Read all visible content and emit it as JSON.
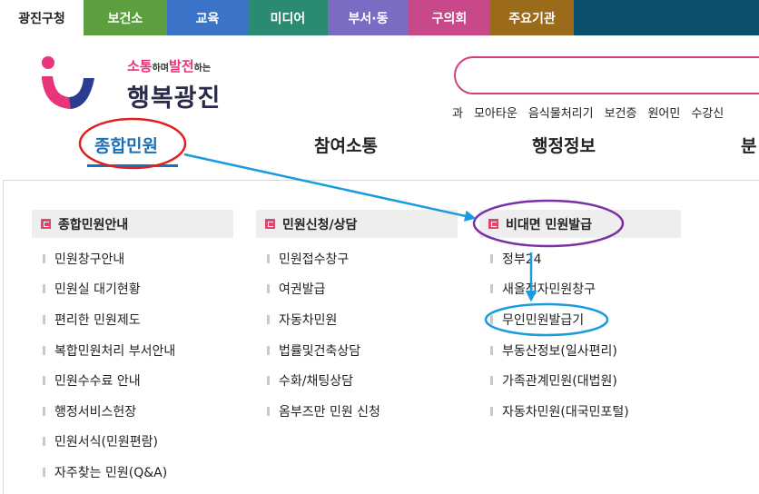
{
  "top_tabs": [
    {
      "label": "광진구청",
      "color": "#ffffff"
    },
    {
      "label": "보건소",
      "color": "#5d9e3f"
    },
    {
      "label": "교육",
      "color": "#3a73c7"
    },
    {
      "label": "미디어",
      "color": "#2a8a72"
    },
    {
      "label": "부서·동",
      "color": "#7b6bc2"
    },
    {
      "label": "구의회",
      "color": "#c8488a"
    },
    {
      "label": "주요기관",
      "color": "#9b6a1a"
    }
  ],
  "logo": {
    "slogan_1": "소통",
    "slogan_2": "하며",
    "slogan_3": "발전",
    "slogan_4": "하는",
    "title": "행복광진"
  },
  "quick_links": [
    "과",
    "모아타운",
    "음식물처리기",
    "보건증",
    "원어민",
    "수강신"
  ],
  "gnb": [
    "종합민원",
    "참여소통",
    "행정정보",
    "분"
  ],
  "columns": [
    {
      "title": "종합민원안내",
      "items": [
        "민원창구안내",
        "민원실 대기현황",
        "편리한 민원제도",
        "복합민원처리 부서안내",
        "민원수수료 안내",
        "행정서비스헌장",
        "민원서식(민원편람)",
        "자주찾는 민원(Q&A)"
      ]
    },
    {
      "title": "민원신청/상담",
      "items": [
        "민원접수창구",
        "여권발급",
        "자동차민원",
        "법률및건축상담",
        "수화/채팅상담",
        "옴부즈만 민원 신청"
      ]
    },
    {
      "title": "비대면 민원발급",
      "items": [
        "정부24",
        "새올전자민원창구",
        "무인민원발급기",
        "부동산정보(일사편리)",
        "가족관계민원(대법원)",
        "자동차민원(대국민포털)"
      ]
    }
  ],
  "colors": {
    "brand_blue": "#1b6fb5",
    "brand_pink": "#d63d7f",
    "top_bar": "#0a4f6b",
    "anno_red": "#e02020",
    "anno_purple": "#7b2fa6",
    "anno_blue": "#1a9be0"
  }
}
